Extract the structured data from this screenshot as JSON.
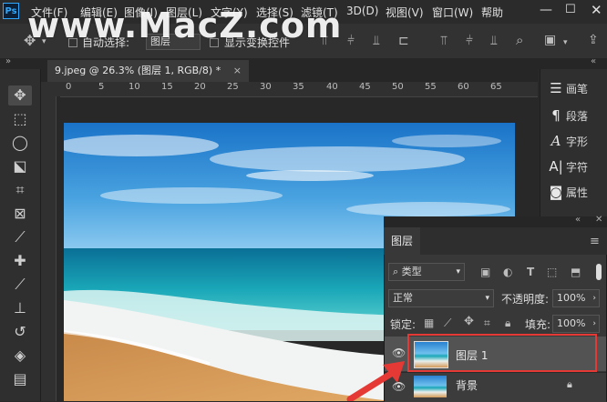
{
  "menubar": {
    "app_icon": "Ps",
    "items": [
      "文件(F)",
      "编辑(E)",
      "图像(I)",
      "图层(L)",
      "文字(Y)",
      "选择(S)",
      "滤镜(T)",
      "3D(D)",
      "视图(V)",
      "窗口(W)",
      "帮助"
    ]
  },
  "watermark": "www.MacZ.com",
  "options": {
    "auto_select_label": "自动选择:",
    "auto_select_value": "图层",
    "show_transform_label": "显示变换控件"
  },
  "document": {
    "tab_label": "9.jpeg @ 26.3% (图层 1, RGB/8) *",
    "close": "×"
  },
  "ruler": {
    "h_ticks": [
      "0",
      "5",
      "10",
      "15",
      "20",
      "25",
      "30",
      "35",
      "40",
      "45",
      "50",
      "55",
      "60",
      "65"
    ]
  },
  "right_panel": {
    "items": [
      {
        "icon": "brush-icon",
        "label": "画笔"
      },
      {
        "icon": "paragraph-icon",
        "label": "段落"
      },
      {
        "icon": "character-icon",
        "label": "字形"
      },
      {
        "icon": "glyphs-icon",
        "label": "字符"
      },
      {
        "icon": "properties-icon",
        "label": "属性"
      }
    ]
  },
  "layers_panel": {
    "tab": "图层",
    "filter_label": "类型",
    "blend_mode": "正常",
    "opacity_label": "不透明度:",
    "opacity_value": "100%",
    "lock_label": "锁定:",
    "fill_label": "填充:",
    "fill_value": "100%",
    "layers": [
      {
        "name": "图层 1",
        "selected": true
      },
      {
        "name": "背景",
        "locked": true
      }
    ]
  },
  "colors": {
    "accent_blue": "#31a8ff",
    "highlight_red": "#e53935"
  }
}
